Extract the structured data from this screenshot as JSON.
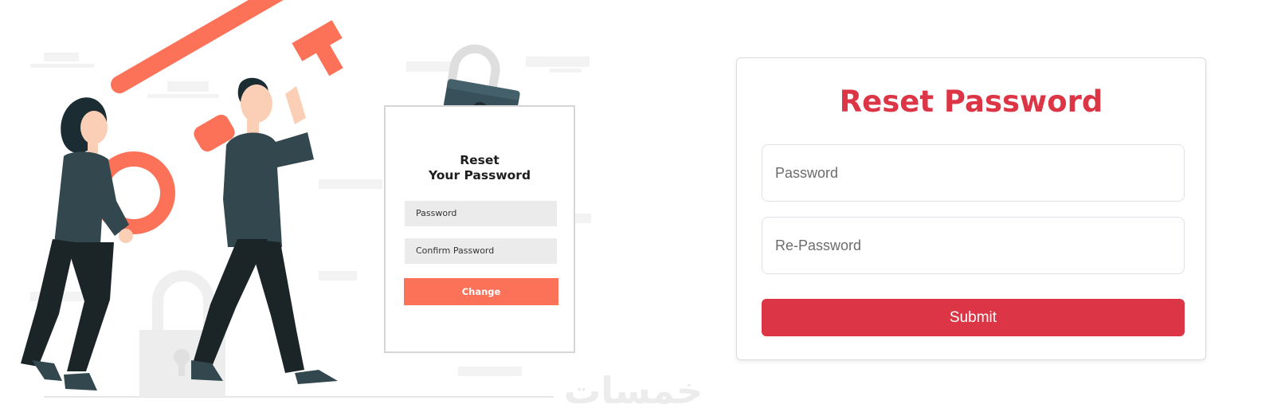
{
  "illustration": {
    "mock_title_line1": "Reset",
    "mock_title_line2": "Your Password",
    "mock_password_label": "Password",
    "mock_confirm_label": "Confirm Password",
    "mock_change_label": "Change",
    "watermark_text": "خمسات"
  },
  "form": {
    "title": "Reset Password",
    "password_placeholder": "Password",
    "repassword_placeholder": "Re-Password",
    "submit_label": "Submit"
  },
  "colors": {
    "accent": "#dc3545",
    "illustration_accent": "#fb7258",
    "figure_dark": "#2e464f"
  }
}
